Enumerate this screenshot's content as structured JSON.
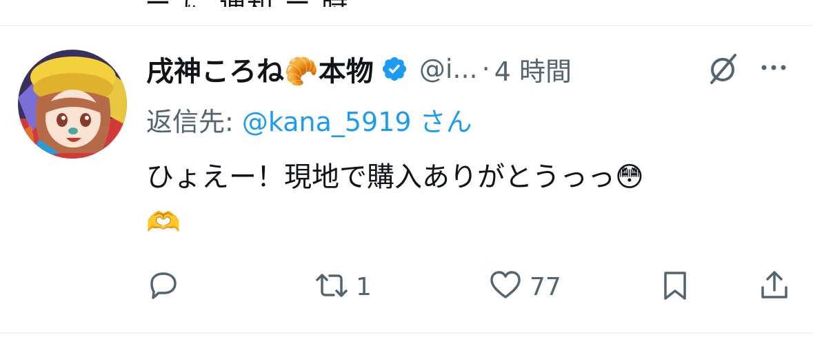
{
  "previous_tweet": {
    "partial_text": "ー に 通知 ー 時"
  },
  "tweet": {
    "display_name": "戌神ころね🥐本物",
    "handle": "@i...",
    "separator": "·",
    "time": "4 時間",
    "reply_prefix": "返信先: ",
    "reply_mention": "@kana_5919",
    "reply_suffix": " さん",
    "body": "ひょえー！現地で購入ありがとうっっ😳",
    "body_line2": "🫶",
    "verified_color": "#1d9bf0"
  },
  "actions": {
    "reply": {
      "icon": "reply-icon",
      "count": ""
    },
    "retweet": {
      "icon": "retweet-icon",
      "count": "1"
    },
    "like": {
      "icon": "heart-icon",
      "count": "77"
    },
    "bookmark": {
      "icon": "bookmark-icon",
      "count": ""
    },
    "share": {
      "icon": "share-icon",
      "count": ""
    }
  },
  "colors": {
    "text": "#0f1419",
    "secondary": "#536471",
    "link": "#1d9bf0",
    "divider": "#eff3f4"
  }
}
